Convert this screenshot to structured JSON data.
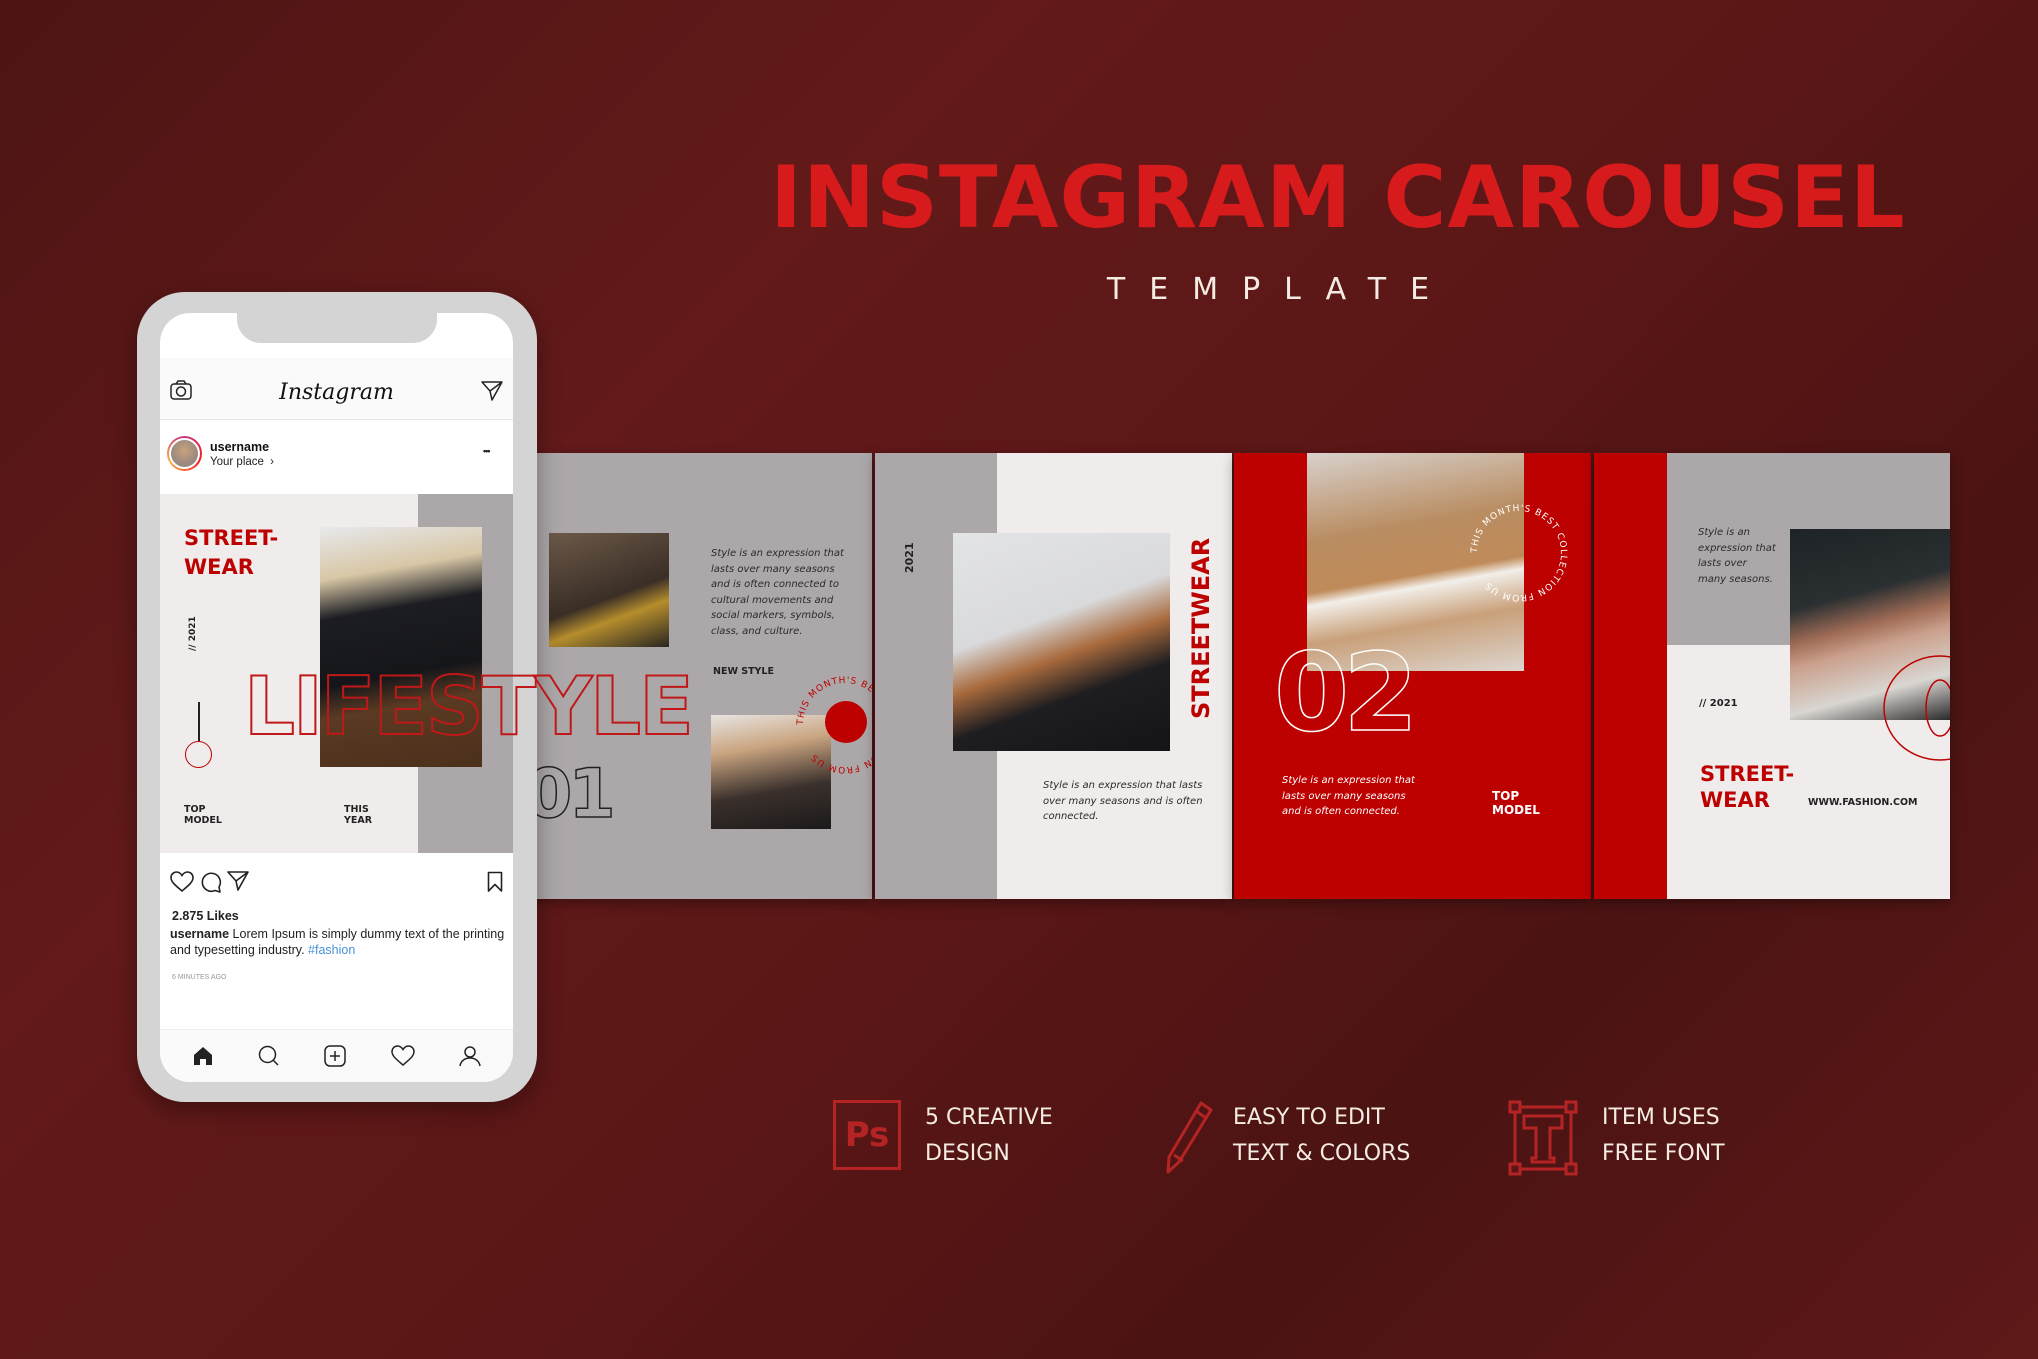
{
  "header": {
    "title": "INSTAGRAM CAROUSEL",
    "subtitle": "TEMPLATE"
  },
  "colors": {
    "accent_red": "#bd0000",
    "title_red": "#d71a1c",
    "background": "#5a1616",
    "panel_gray": "#aca7a9",
    "panel_light": "#f0ecec",
    "hashtag_blue": "#4a90d9"
  },
  "phone": {
    "app_name": "Instagram",
    "header_icons": [
      "camera-icon",
      "send-icon"
    ],
    "post": {
      "username": "username",
      "location": "Your place",
      "location_chevron": "›",
      "more": "•••",
      "likes": "2.875 Likes",
      "caption_user": "username",
      "caption_text": " Lorem Ipsum is simply dummy text of the printing and typesetting industry. ",
      "hashtag": "#fashion",
      "time": "6 MINUTES AGO"
    },
    "action_icons": [
      "heart-icon",
      "comment-icon",
      "share-icon",
      "bookmark-icon"
    ],
    "nav_icons": [
      "home-icon",
      "search-icon",
      "add-icon",
      "activity-heart-icon",
      "profile-icon"
    ]
  },
  "slides": [
    {
      "title_line1": "STREET-",
      "title_line2": "WEAR",
      "year": "// 2021",
      "overlay_word": "LIFESTYLE",
      "label_left_1": "TOP",
      "label_left_2": "MODEL",
      "label_right_1": "THIS",
      "label_right_2": "YEAR"
    },
    {
      "body": "Style is an expression that lasts over many seasons and is often connected to cultural movements and social markers, symbols, class, and culture.",
      "tag": "NEW STYLE",
      "number": "01",
      "circle_text": "THIS MONTH'S BEST COLLECTION FROM US"
    },
    {
      "year": "2021",
      "vertical_title": "STREETWEAR",
      "body": "Style is an expression that lasts over many seasons and is often connected."
    },
    {
      "number": "02",
      "circle_text": "THIS MONTH'S BEST COLLECTION FROM US",
      "body": "Style is an expression that lasts over many seasons and is often connected.",
      "label_1": "TOP",
      "label_2": "MODEL"
    },
    {
      "body": "Style is an expression that lasts over many seasons.",
      "year": "// 2021",
      "title_line1": "STREET-",
      "title_line2": "WEAR",
      "website": "WWW.FASHION.COM",
      "number_partial": "0"
    }
  ],
  "features": [
    {
      "icon": "photoshop-icon",
      "icon_text": "Ps",
      "line1": "5 CREATIVE",
      "line2": "DESIGN"
    },
    {
      "icon": "pencil-icon",
      "line1": "EASY TO EDIT",
      "line2": "TEXT & COLORS"
    },
    {
      "icon": "font-icon",
      "icon_text": "T",
      "line1": "ITEM USES",
      "line2": "FREE FONT"
    }
  ]
}
